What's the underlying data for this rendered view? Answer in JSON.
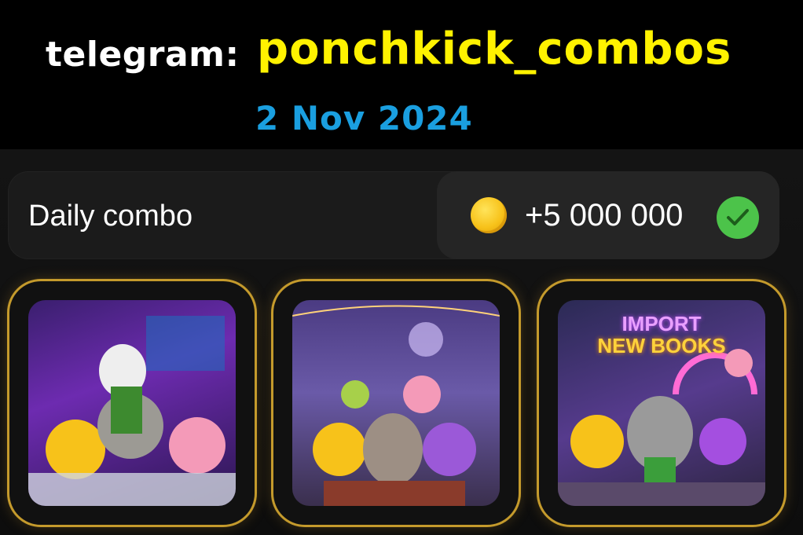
{
  "header": {
    "telegram_label": "telegram:",
    "channel": "ponchkick_combos",
    "date": "2 Nov 2024"
  },
  "combo": {
    "title": "Daily combo",
    "reward": "+5 000 000",
    "reward_icon": "coin-icon",
    "status_icon": "check-icon"
  },
  "cards": [
    {
      "name": "combo-card-1",
      "image": "market-analysis-characters"
    },
    {
      "name": "combo-card-2",
      "image": "meditation-characters"
    },
    {
      "name": "combo-card-3",
      "image": "import-new-books-characters",
      "sign_line1": "IMPORT",
      "sign_line2": "NEW BOOKS"
    }
  ],
  "colors": {
    "channel": "#fff200",
    "date": "#1a9fe0",
    "card_border": "#c49a2c",
    "check": "#4cc34a",
    "coin": "#f7c21a"
  }
}
